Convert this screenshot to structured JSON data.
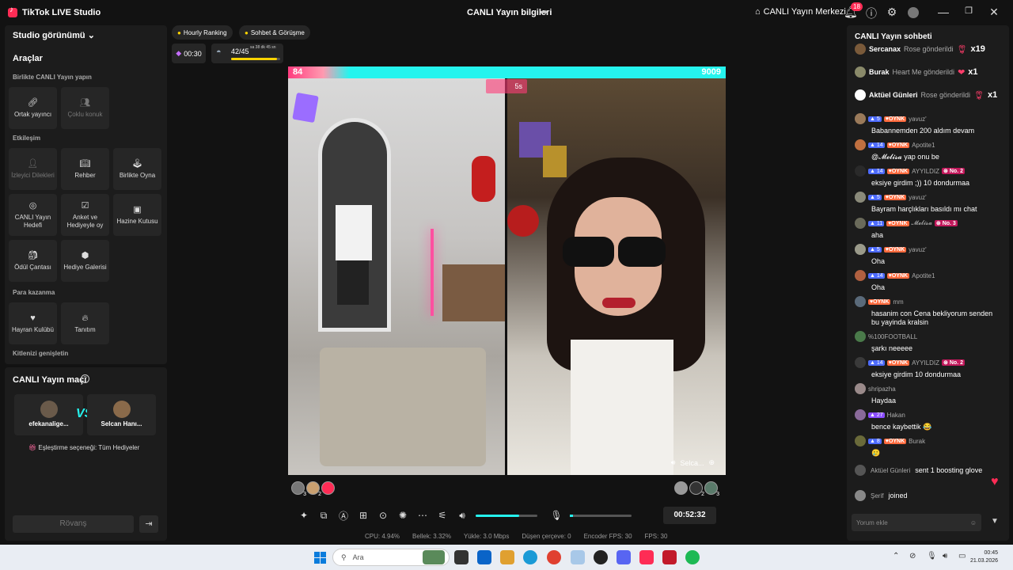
{
  "titlebar": {
    "app_title": "TikTok LIVE Studio",
    "center_title": "CANLI Yayın bilgileri",
    "center_link": "CANLI Yayın Merkezi",
    "notification_count": "18"
  },
  "left": {
    "studio_view": "Studio görünümü",
    "tools_title": "Araçlar",
    "group_together": "Birlikte CANLI Yayın yapın",
    "tile_cohost": "Ortak yayıncı",
    "tile_multi_guest": "Çoklu konuk",
    "group_interaction": "Etkileşim",
    "tile_viewer_requests": "İzleyici Dilekleri",
    "tile_guide": "Rehber",
    "tile_play_together": "Birlikte Oyna",
    "tile_live_goal": "CANLI Yayın Hedefi",
    "tile_poll": "Anket ve Hediyeyle oy",
    "tile_treasure": "Hazine Kutusu",
    "tile_reward_bag": "Ödül Çantası",
    "tile_gift_gallery": "Hediye Galerisi",
    "group_monetize": "Para kazanma",
    "tile_fan_club": "Hayran Kulübü",
    "tile_promote": "Tanıtım",
    "group_expand": "Kitlenizi genişletin"
  },
  "match": {
    "title": "CANLI Yayın maçı",
    "player1": "efekanalige...",
    "player2": "Selcan Hanı...",
    "vs": "VS",
    "pairing": "Eşleştirme seçeneği: Tüm Hediyeler",
    "rematch": "Rövanş"
  },
  "top_chips": {
    "hourly": "Hourly Ranking",
    "sohbet": "Sohbet & Görüşme",
    "timer": "00:30",
    "quest_count": "42/45",
    "quest_time": "sa 38 dk 45 sn",
    "quest_progress": 0.93
  },
  "stage": {
    "score_left": "84",
    "score_right": "9009",
    "round_timer": "5s",
    "remote_name": "Selca..."
  },
  "supporters_left": [
    "3",
    "2",
    ""
  ],
  "supporters_right": [
    "",
    "2",
    "3"
  ],
  "controls": {
    "duration": "00:52:32",
    "volume": 0.71,
    "mic": 0.05
  },
  "stats": {
    "cpu": "CPU: 4.94%",
    "memory": "Bellek: 3.32%",
    "upload": "Yükle: 3.0 Mbps",
    "dropped": "Düşen çerçeve: 0",
    "encoder_fps": "Encoder FPS: 30",
    "fps": "FPS: 30"
  },
  "chat": {
    "title": "CANLI Yayın sohbeti",
    "gifts": [
      {
        "user": "Sercanax",
        "action": "Rose gönderildi",
        "count": "x19"
      },
      {
        "user": "Burak",
        "action": "Heart Me gönderildi",
        "count": "x1"
      },
      {
        "user": "Aktüel Günleri",
        "action": "Rose gönderildi",
        "count": "x1"
      }
    ],
    "messages": [
      {
        "lvl": "5",
        "fan": "OYNK",
        "user": "yavuz'",
        "rank": "",
        "text": "Babannemden 200 aldım devam"
      },
      {
        "lvl": "14",
        "fan": "OYNK",
        "user": "Apotite1",
        "rank": "",
        "text": "@𝓜𝓮𝓵𝓲𝓼𝓪 yap onu be"
      },
      {
        "lvl": "14",
        "fan": "OYNK",
        "user": "AYYILDIZ",
        "rank": "No. 2",
        "text": "eksiye girdim ;)) 10 dondurmaa"
      },
      {
        "lvl": "5",
        "fan": "OYNK",
        "user": "yavuz'",
        "rank": "",
        "text": "Bayram harçlıkları basıldı mı chat"
      },
      {
        "lvl": "11",
        "fan": "OYNK",
        "user": "𝓜𝓮𝓵𝓲𝓼𝓪",
        "rank": "No. 3",
        "text": "aha"
      },
      {
        "lvl": "5",
        "fan": "OYNK",
        "user": "yavuz'",
        "rank": "",
        "text": "Oha"
      },
      {
        "lvl": "14",
        "fan": "OYNK",
        "user": "Apotite1",
        "rank": "",
        "text": "Oha"
      },
      {
        "lvl": "",
        "fan": "OYNK",
        "user": "mm",
        "rank": "",
        "text": "hasanim con Cena bekliyorum senden bu yayinda kralsin"
      },
      {
        "lvl": "",
        "fan": "",
        "user": "%100FOOTBALL",
        "rank": "",
        "text": "şarkı neeeee"
      },
      {
        "lvl": "14",
        "fan": "OYNK",
        "user": "AYYILDIZ",
        "rank": "No. 2",
        "text": "eksiye girdim 10 dondurmaa"
      },
      {
        "lvl": "",
        "fan": "",
        "user": "shripazha",
        "rank": "",
        "text": "Haydaa"
      },
      {
        "lvl": "27",
        "fan": "",
        "user": "Hakan",
        "rank": "",
        "text": "bence kaybettik 😂"
      },
      {
        "lvl": "8",
        "fan": "OYNK",
        "user": "Burak",
        "rank": "",
        "text": "🥲"
      }
    ],
    "sys1_user": "Aktüel Günleri",
    "sys1_text": "sent 1 boosting glove",
    "sys2_user": "Şerif",
    "sys2_text": "joined",
    "input_placeholder": "Yorum ekle"
  },
  "taskbar": {
    "search": "Ara",
    "time": "00:45",
    "date": "21.03.2026"
  }
}
